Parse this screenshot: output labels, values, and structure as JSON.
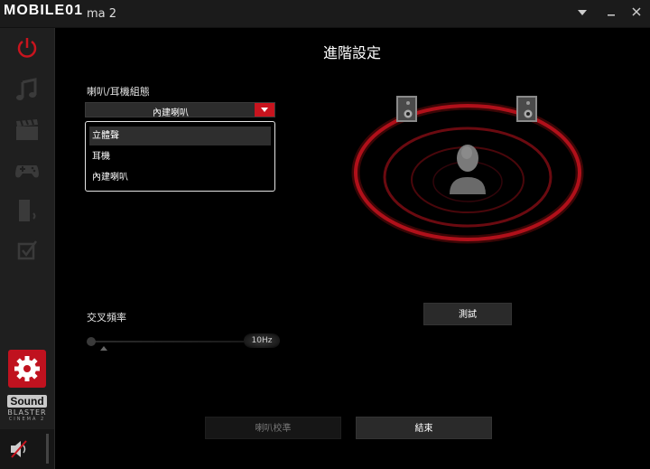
{
  "window": {
    "brand": "MOBILE01",
    "title": "ma 2",
    "min_icon": "chevron-down-icon",
    "restore_icon": "minimize-icon",
    "close_icon": "close-icon"
  },
  "sidebar": {
    "items": [
      {
        "icon": "power-icon"
      },
      {
        "icon": "music-note-icon"
      },
      {
        "icon": "movie-clapper-icon"
      },
      {
        "icon": "gamepad-icon"
      },
      {
        "icon": "voice-icon"
      },
      {
        "icon": "checkbox-icon"
      }
    ],
    "settings_icon": "gear-icon",
    "logo": {
      "line1": "Sound",
      "line2": "BLASTER",
      "line3": "CINEMA 2"
    },
    "volume_icon": "speaker-muted-icon"
  },
  "page": {
    "heading": "進階設定",
    "speaker_config_label": "喇叭/耳機組態",
    "speaker_config_value": "內建喇叭",
    "options": [
      "立體聲",
      "耳機",
      "內建喇叭"
    ],
    "crossover_label": "交叉頻率",
    "crossover_value": "10Hz",
    "test_button": "測試",
    "calibrate_button": "喇叭校準",
    "done_button": "結束"
  },
  "colors": {
    "accent": "#c8141e",
    "background": "#000000",
    "sidebar": "#1f1f1f"
  }
}
